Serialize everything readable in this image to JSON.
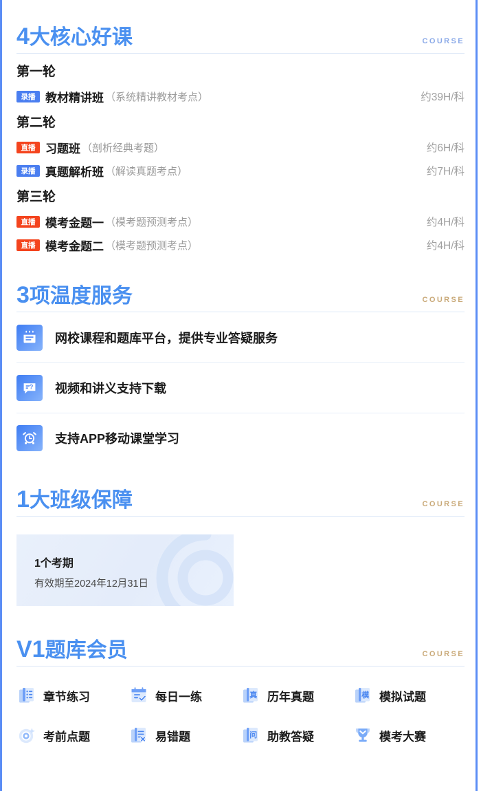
{
  "sections": {
    "course": {
      "title_lead": "4",
      "title_rest": "大核心好课",
      "kicker": "COURSE",
      "rounds": [
        {
          "label": "第一轮",
          "items": [
            {
              "badge": "录播",
              "badge_type": "rec",
              "name": "教材精讲班",
              "sub": "（系统精讲教材考点）",
              "hours": "约39H/科"
            }
          ]
        },
        {
          "label": "第二轮",
          "items": [
            {
              "badge": "直播",
              "badge_type": "live",
              "name": "习题班",
              "sub": "（剖析经典考题）",
              "hours": "约6H/科"
            },
            {
              "badge": "录播",
              "badge_type": "rec",
              "name": "真题解析班",
              "sub": "（解读真题考点）",
              "hours": "约7H/科"
            }
          ]
        },
        {
          "label": "第三轮",
          "items": [
            {
              "badge": "直播",
              "badge_type": "live",
              "name": "模考金题一",
              "sub": "（模考题预测考点）",
              "hours": "约4H/科"
            },
            {
              "badge": "直播",
              "badge_type": "live",
              "name": "模考金题二",
              "sub": "（模考题预测考点）",
              "hours": "约4H/科"
            }
          ]
        }
      ]
    },
    "service": {
      "title_lead": "3",
      "title_rest": "项温度服务",
      "kicker": "COURSE",
      "items": [
        {
          "icon": "notebook-icon",
          "text": "网校课程和题库平台，提供专业答疑服务"
        },
        {
          "icon": "chat-question-icon",
          "text": "视频和讲义支持下载"
        },
        {
          "icon": "alarm-clock-icon",
          "text": "支持APP移动课堂学习"
        }
      ]
    },
    "guarantee": {
      "title_lead": "1",
      "title_rest": "大班级保障",
      "kicker": "COURSE",
      "card": {
        "title": "1个考期",
        "sub": "有效期至2024年12月31日"
      }
    },
    "member": {
      "title_lead": "V1",
      "title_rest": "题库会员",
      "kicker": "COURSE",
      "items": [
        {
          "icon": "chapter-list-icon",
          "label": "章节练习"
        },
        {
          "icon": "daily-check-icon",
          "label": "每日一练"
        },
        {
          "icon": "real-exam-icon",
          "label": "历年真题"
        },
        {
          "icon": "mock-exam-icon",
          "label": "模拟试题"
        },
        {
          "icon": "target-icon",
          "label": "考前点题"
        },
        {
          "icon": "wrong-question-icon",
          "label": "易错题"
        },
        {
          "icon": "assistant-qa-icon",
          "label": "助教答疑"
        },
        {
          "icon": "trophy-icon",
          "label": "模考大赛"
        }
      ]
    }
  },
  "colors": {
    "accent_blue": "#4a90f0",
    "rail_blue": "#5b8df5",
    "badge_live_red": "#f4441e",
    "badge_rec_blue": "#4a7ef0",
    "kicker_gold": "#c9a978",
    "kicker_blue": "#8aa9e8",
    "rule": "#dce7f7"
  }
}
